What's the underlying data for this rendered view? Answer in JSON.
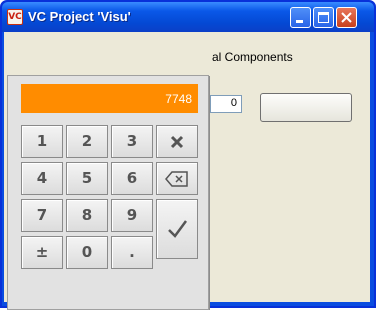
{
  "window": {
    "title": "VC Project 'Visu'",
    "icon_text": "VC",
    "icon": "vc-app-icon",
    "buttons": [
      "minimize-icon",
      "maximize-icon",
      "close-icon"
    ],
    "title_color": "#0a58e8",
    "close_color": "#c8401c"
  },
  "form": {
    "label_partial": "al Components",
    "number_field_value": "0",
    "button_label": ""
  },
  "keypad": {
    "display_value": "7748",
    "display_color": "#ff8c00",
    "keys": {
      "k1": "1",
      "k2": "2",
      "k3": "3",
      "k4": "4",
      "k5": "5",
      "k6": "6",
      "k7": "7",
      "k8": "8",
      "k9": "9",
      "plus_minus": "±",
      "k0": "0",
      "decimal": "."
    },
    "icons": {
      "clear": "x-icon",
      "backspace": "backspace-icon",
      "enter": "checkmark-icon"
    }
  }
}
